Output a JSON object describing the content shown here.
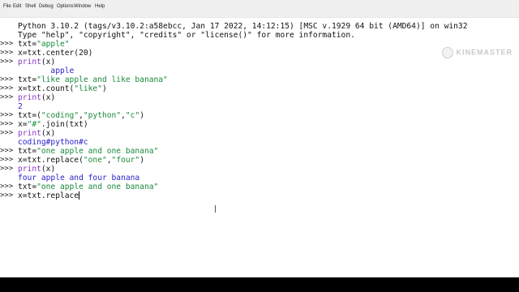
{
  "menu": [
    "File",
    "Edit",
    "Shell",
    "Debug",
    "Options",
    "Window",
    "Help"
  ],
  "banner": [
    "Python 3.10.2 (tags/v3.10.2:a58ebcc, Jan 17 2022, 14:12:15) [MSC v.1929 64 bit (AMD64)] on win32",
    "Type \"help\", \"copyright\", \"credits\" or \"license()\" for more information."
  ],
  "prompt": ">>>",
  "session": [
    {
      "t": "in",
      "parts": [
        [
          "txt=",
          ""
        ],
        [
          "\"apple\"",
          "str"
        ]
      ]
    },
    {
      "t": "in",
      "parts": [
        [
          "x=txt.center(20)",
          ""
        ]
      ]
    },
    {
      "t": "in",
      "parts": [
        [
          "print",
          "kw"
        ],
        [
          "(x)",
          ""
        ]
      ]
    },
    {
      "t": "out",
      "text": "       apple        "
    },
    {
      "t": "in",
      "parts": [
        [
          "txt=",
          ""
        ],
        [
          "\"like apple and like banana\"",
          "str"
        ]
      ]
    },
    {
      "t": "in",
      "parts": [
        [
          "x=txt.count(",
          ""
        ],
        [
          "\"like\"",
          "str"
        ],
        [
          ")",
          ""
        ]
      ]
    },
    {
      "t": "in",
      "parts": [
        [
          "print",
          "kw"
        ],
        [
          "(x)",
          ""
        ]
      ]
    },
    {
      "t": "out",
      "text": "2"
    },
    {
      "t": "in",
      "parts": [
        [
          "txt=(",
          ""
        ],
        [
          "\"coding\"",
          "str"
        ],
        [
          ",",
          ""
        ],
        [
          "\"python\"",
          "str"
        ],
        [
          ",",
          ""
        ],
        [
          "\"c\"",
          "str"
        ],
        [
          ")",
          ""
        ]
      ]
    },
    {
      "t": "in",
      "parts": [
        [
          "x=",
          ""
        ],
        [
          "\"#\"",
          "str"
        ],
        [
          ".join(txt)",
          ""
        ]
      ]
    },
    {
      "t": "in",
      "parts": [
        [
          "print",
          "kw"
        ],
        [
          "(x)",
          ""
        ]
      ]
    },
    {
      "t": "out",
      "text": "coding#python#c"
    },
    {
      "t": "in",
      "parts": [
        [
          "txt=",
          ""
        ],
        [
          "\"one apple and one banana\"",
          "str"
        ]
      ]
    },
    {
      "t": "in",
      "parts": [
        [
          "x=txt.replace(",
          ""
        ],
        [
          "\"one\"",
          "str"
        ],
        [
          ",",
          ""
        ],
        [
          "\"four\"",
          "str"
        ],
        [
          ")",
          ""
        ]
      ]
    },
    {
      "t": "in",
      "parts": [
        [
          "print",
          "kw"
        ],
        [
          "(x)",
          ""
        ]
      ]
    },
    {
      "t": "out",
      "text": "four apple and four banana"
    },
    {
      "t": "in",
      "parts": [
        [
          "txt=",
          ""
        ],
        [
          "\"one apple and one banana\"",
          "str"
        ]
      ]
    },
    {
      "t": "in",
      "parts": [
        [
          "x=txt.replace",
          ""
        ]
      ],
      "current": true
    }
  ],
  "watermark": "KINEMASTER"
}
